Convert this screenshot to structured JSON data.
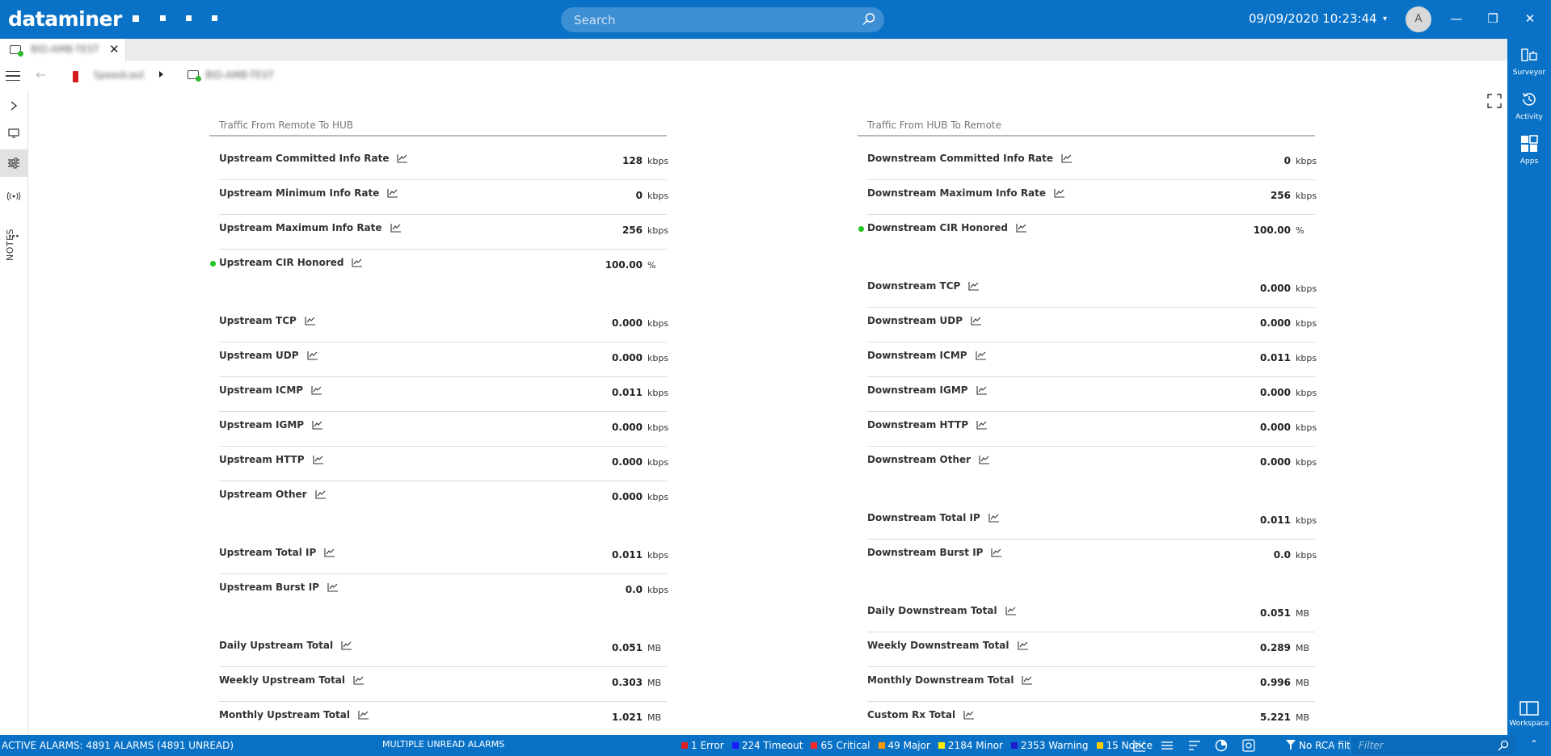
{
  "app": {
    "logo": "dataminer",
    "search_placeholder": "Search",
    "datetime": "09/09/2020 10:23:44",
    "avatar_initial": "A"
  },
  "tab": {
    "label": "BID-AMB-TEST"
  },
  "breadcrumb": {
    "item1": "Speedcast",
    "item2": "BID-AMB-TEST"
  },
  "leftbar": {
    "notes_label": "NOTES"
  },
  "rightbar": {
    "items": [
      "Surveyor",
      "Activity",
      "Apps"
    ],
    "workspace_label": "Workspace"
  },
  "left_section": {
    "title": "Traffic From Remote To HUB",
    "rows": [
      {
        "label": "Upstream Committed Info Rate",
        "value": "128",
        "unit": "kbps",
        "dot": false
      },
      {
        "label": "Upstream Minimum Info Rate",
        "value": "0",
        "unit": "kbps",
        "dot": false
      },
      {
        "label": "Upstream Maximum Info Rate",
        "value": "256",
        "unit": "kbps",
        "dot": false
      },
      {
        "label": "Upstream CIR Honored",
        "value": "100.00",
        "unit": "%",
        "dot": true
      },
      {
        "label": "Upstream TCP",
        "value": "0.000",
        "unit": "kbps",
        "dot": false
      },
      {
        "label": "Upstream UDP",
        "value": "0.000",
        "unit": "kbps",
        "dot": false
      },
      {
        "label": "Upstream ICMP",
        "value": "0.011",
        "unit": "kbps",
        "dot": false
      },
      {
        "label": "Upstream IGMP",
        "value": "0.000",
        "unit": "kbps",
        "dot": false
      },
      {
        "label": "Upstream HTTP",
        "value": "0.000",
        "unit": "kbps",
        "dot": false
      },
      {
        "label": "Upstream Other",
        "value": "0.000",
        "unit": "kbps",
        "dot": false
      },
      {
        "label": "Upstream Total IP",
        "value": "0.011",
        "unit": "kbps",
        "dot": false
      },
      {
        "label": "Upstream Burst IP",
        "value": "0.0",
        "unit": "kbps",
        "dot": false
      },
      {
        "label": "Daily Upstream Total",
        "value": "0.051",
        "unit": "MB",
        "dot": false
      },
      {
        "label": "Weekly Upstream Total",
        "value": "0.303",
        "unit": "MB",
        "dot": false
      },
      {
        "label": "Monthly Upstream Total",
        "value": "1.021",
        "unit": "MB",
        "dot": false
      }
    ]
  },
  "right_section": {
    "title": "Traffic From HUB To Remote",
    "rows": [
      {
        "label": "Downstream Committed Info Rate",
        "value": "0",
        "unit": "kbps",
        "dot": false
      },
      {
        "label": "Downstream Maximum Info Rate",
        "value": "256",
        "unit": "kbps",
        "dot": false
      },
      {
        "label": "Downstream CIR Honored",
        "value": "100.00",
        "unit": "%",
        "dot": true
      },
      {
        "label": "Downstream TCP",
        "value": "0.000",
        "unit": "kbps",
        "dot": false
      },
      {
        "label": "Downstream UDP",
        "value": "0.000",
        "unit": "kbps",
        "dot": false
      },
      {
        "label": "Downstream ICMP",
        "value": "0.011",
        "unit": "kbps",
        "dot": false
      },
      {
        "label": "Downstream IGMP",
        "value": "0.000",
        "unit": "kbps",
        "dot": false
      },
      {
        "label": "Downstream HTTP",
        "value": "0.000",
        "unit": "kbps",
        "dot": false
      },
      {
        "label": "Downstream Other",
        "value": "0.000",
        "unit": "kbps",
        "dot": false
      },
      {
        "label": "Downstream Total IP",
        "value": "0.011",
        "unit": "kbps",
        "dot": false
      },
      {
        "label": "Downstream Burst IP",
        "value": "0.0",
        "unit": "kbps",
        "dot": false
      },
      {
        "label": "Daily Downstream Total",
        "value": "0.051",
        "unit": "MB",
        "dot": false
      },
      {
        "label": "Weekly Downstream Total",
        "value": "0.289",
        "unit": "MB",
        "dot": false
      },
      {
        "label": "Monthly Downstream Total",
        "value": "0.996",
        "unit": "MB",
        "dot": false
      },
      {
        "label": "Custom Rx Total",
        "value": "5.221",
        "unit": "MB",
        "dot": false
      }
    ]
  },
  "statusbar": {
    "active_alarms": "ACTIVE ALARMS: 4891 ALARMS (4891 UNREAD)",
    "middle": "MULTIPLE UNREAD ALARMS",
    "counts": [
      {
        "label": "1 Error",
        "color": "#e02020"
      },
      {
        "label": "224 Timeout",
        "color": "#1a1aff"
      },
      {
        "label": "65 Critical",
        "color": "#ff2a2a"
      },
      {
        "label": "49 Major",
        "color": "#ff9900"
      },
      {
        "label": "2184 Minor",
        "color": "#ffee00"
      },
      {
        "label": "2353 Warning",
        "color": "#1d1dcc"
      },
      {
        "label": "15 Notice",
        "color": "#ffcc00"
      }
    ],
    "rca": "No RCA filter",
    "filter_placeholder": "Filter"
  },
  "colors": {
    "brand": "#0a72c6",
    "ok_dot": "#22c322"
  }
}
